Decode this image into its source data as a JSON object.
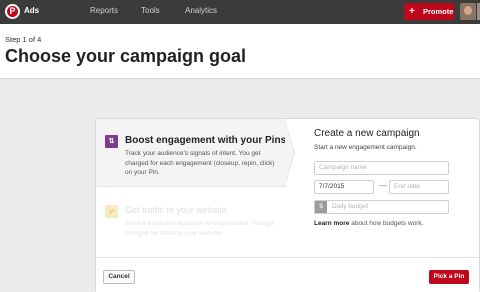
{
  "nav": {
    "logo_glyph": "P",
    "app_name": "Ads",
    "items": [
      {
        "label": "Reports"
      },
      {
        "label": "Tools"
      },
      {
        "label": "Analytics"
      }
    ],
    "promote_plus": "+",
    "promote_label": "Promote"
  },
  "header": {
    "step": "Step 1 of 4",
    "title": "Choose your campaign goal"
  },
  "goals": [
    {
      "icon": "engagement-icon",
      "icon_glyph": "⇅",
      "title": "Boost engagement with your Pins",
      "description": "Track your audience's signals of intent. You get charged for each engagement (closeup, repin, click) on your Pin.",
      "selected": true
    },
    {
      "icon": "traffic-icon",
      "icon_glyph": "⬈",
      "title": "Get traffic to your website",
      "description": "Send a motivated audience to your content. You get charged for clicks to your website.",
      "selected": false
    }
  ],
  "form": {
    "title": "Create a new campaign",
    "subtitle": "Start a new engagement campaign.",
    "campaign_name_placeholder": "Campaign name",
    "start_date": "7/7/2015",
    "date_separator": "—",
    "end_date_placeholder": "End date",
    "currency_symbol": "$",
    "budget_placeholder": "Daily budget",
    "learn_more_link": "Learn more",
    "learn_more_text": " about how budgets work."
  },
  "footer": {
    "cancel_label": "Cancel",
    "pick_label": "Pick a Pin"
  },
  "colors": {
    "brand_red": "#bd081c",
    "topbar": "#3b3b3b",
    "engagement_icon": "#7f3b8f"
  }
}
